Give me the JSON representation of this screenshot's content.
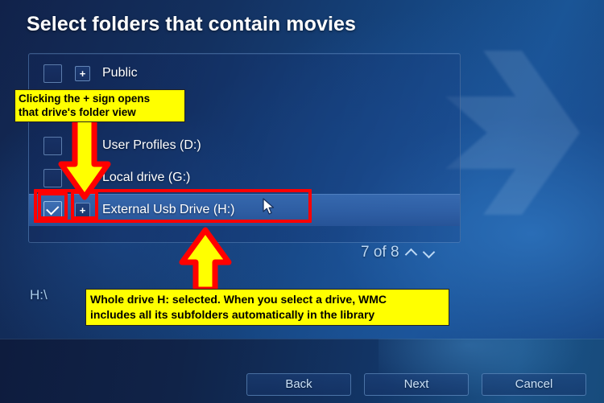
{
  "window": {
    "title": "Select folders that contain movies",
    "accent_blue": "#1a5596",
    "panel_border": "#7daadc",
    "highlight_blue": "#396cb2",
    "annotation_yellow": "#ffff00",
    "annotation_red": "#ff0000"
  },
  "folder_list": {
    "rows": [
      {
        "label": "Public",
        "checked": false,
        "has_expand": true,
        "expand_label": "+",
        "selected": false
      },
      {
        "label": "User Profiles (D:)",
        "checked": false,
        "has_expand": true,
        "expand_label": "+",
        "selected": false
      },
      {
        "label": "Local drive (G:)",
        "checked": false,
        "has_expand": true,
        "expand_label": "+",
        "selected": false
      },
      {
        "label": "External Usb Drive (H:)",
        "checked": true,
        "has_expand": true,
        "expand_label": "+",
        "selected": true
      }
    ]
  },
  "pager": {
    "text": "7 of 8",
    "current": 7,
    "total": 8,
    "up_icon": "chevron-up-icon",
    "down_icon": "chevron-down-icon"
  },
  "path": {
    "value": "H:\\"
  },
  "buttons": {
    "back": "Back",
    "next": "Next",
    "cancel": "Cancel"
  },
  "annotations": {
    "plus_note": "Clicking the + sign opens\nthat drive's folder view",
    "drive_note": "Whole drive H: selected. When you select a drive, WMC\nincludes all its subfolders automatically in the library",
    "arrow_down_name": "yellow-down-arrow",
    "arrow_up_name": "yellow-up-arrow"
  }
}
